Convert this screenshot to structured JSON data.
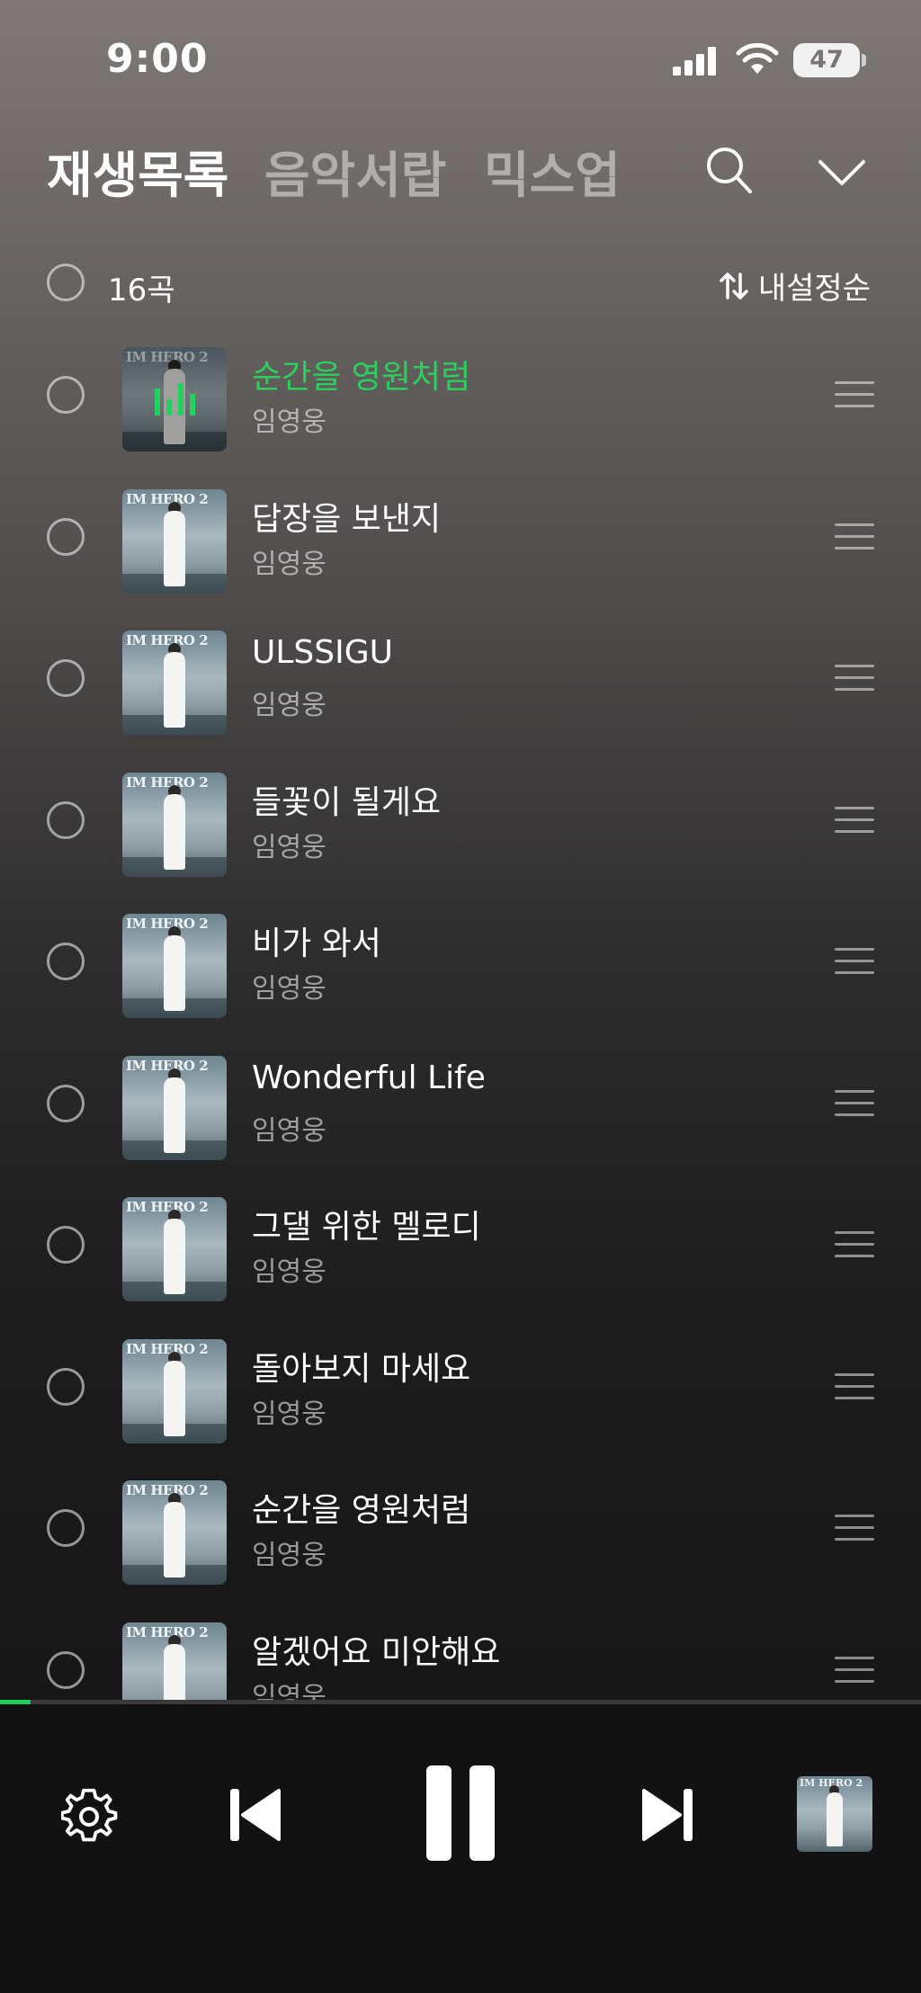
{
  "status_bar": {
    "time": "9:00",
    "battery": "47"
  },
  "header": {
    "tabs": [
      {
        "label": "재생목록",
        "active": true
      },
      {
        "label": "음악서랍",
        "active": false
      },
      {
        "label": "믹스업",
        "active": false
      }
    ],
    "icons": [
      "search-icon",
      "chevron-down-icon"
    ]
  },
  "list_bar": {
    "count": "16곡",
    "sort_label": "내설정순"
  },
  "songs": [
    {
      "title": "순간을 영원처럼",
      "artist": "임영웅",
      "now_playing": true
    },
    {
      "title": "답장을 보낸지",
      "artist": "임영웅"
    },
    {
      "title": "ULSSIGU",
      "artist": "임영웅"
    },
    {
      "title": "들꽃이 될게요",
      "artist": "임영웅"
    },
    {
      "title": "비가 와서",
      "artist": "임영웅"
    },
    {
      "title": "Wonderful Life",
      "artist": "임영웅"
    },
    {
      "title": "그댈 위한 멜로디",
      "artist": "임영웅"
    },
    {
      "title": "돌아보지 마세요",
      "artist": "임영웅"
    },
    {
      "title": "순간을 영원처럼",
      "artist": "임영웅"
    },
    {
      "title": "알겠어요 미안해요",
      "artist": "임영웅"
    }
  ],
  "album_art_text": "IM HERO 2",
  "player": {
    "progress_fraction": 0.033,
    "icons": [
      "settings-icon",
      "previous-icon",
      "pause-icon",
      "next-icon"
    ],
    "accent_color": "#1fd15a"
  }
}
